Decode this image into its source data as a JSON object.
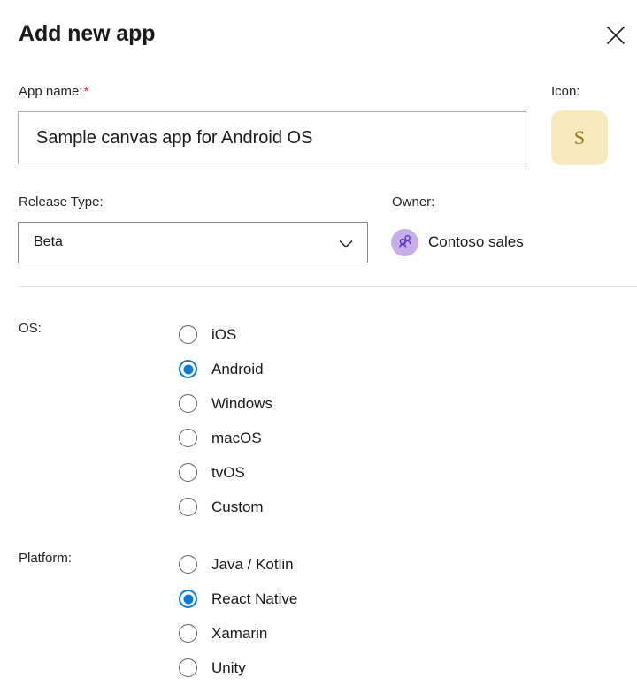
{
  "header": {
    "title": "Add new app",
    "close_icon": "close-icon"
  },
  "app_name": {
    "label": "App name:",
    "required_marker": "*",
    "value": "Sample canvas app for Android OS",
    "placeholder": "App name"
  },
  "icon": {
    "label": "Icon:",
    "letter": "S",
    "background_color": "#f6eabe",
    "text_color": "#9b7615"
  },
  "release_type": {
    "label": "Release Type:",
    "value": "Beta",
    "chevron_icon": "chevron-down-icon",
    "options": [
      "Beta"
    ]
  },
  "owner": {
    "label": "Owner:",
    "name": "Contoso sales",
    "avatar_icon": "people-icon",
    "avatar_color": "#c6aee8",
    "avatar_glyph_color": "#5b2bc4"
  },
  "os_group": {
    "label": "OS:",
    "selected": "Android",
    "options": [
      {
        "label": "iOS",
        "checked": false
      },
      {
        "label": "Android",
        "checked": true
      },
      {
        "label": "Windows",
        "checked": false
      },
      {
        "label": "macOS",
        "checked": false
      },
      {
        "label": "tvOS",
        "checked": false
      },
      {
        "label": "Custom",
        "checked": false
      }
    ]
  },
  "platform_group": {
    "label": "Platform:",
    "selected": "React Native",
    "options": [
      {
        "label": "Java / Kotlin",
        "checked": false
      },
      {
        "label": "React Native",
        "checked": true
      },
      {
        "label": "Xamarin",
        "checked": false
      },
      {
        "label": "Unity",
        "checked": false
      }
    ]
  },
  "theme": {
    "accent_color": "#0b7bd4",
    "required_color": "#d13438",
    "border_color": "#a9a9a9",
    "divider_color": "#e6e6e6"
  }
}
